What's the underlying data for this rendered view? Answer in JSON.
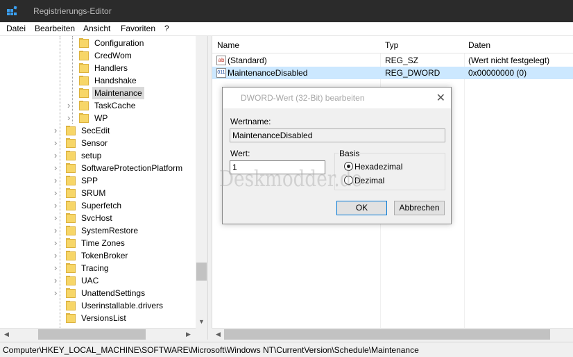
{
  "window": {
    "title": "Registrierungs-Editor"
  },
  "menu": [
    "Datei",
    "Bearbeiten",
    "Ansicht",
    "Favoriten",
    "?"
  ],
  "tree": {
    "level4": [
      {
        "label": "Configuration",
        "expander": false
      },
      {
        "label": "CredWom",
        "expander": false
      },
      {
        "label": "Handlers",
        "expander": false
      },
      {
        "label": "Handshake",
        "expander": false
      },
      {
        "label": "Maintenance",
        "expander": false,
        "selected": true
      },
      {
        "label": "TaskCache",
        "expander": true
      },
      {
        "label": "WP",
        "expander": true
      }
    ],
    "level3": [
      {
        "label": "SecEdit",
        "expander": true
      },
      {
        "label": "Sensor",
        "expander": true
      },
      {
        "label": "setup",
        "expander": true
      },
      {
        "label": "SoftwareProtectionPlatform",
        "expander": true
      },
      {
        "label": "SPP",
        "expander": true
      },
      {
        "label": "SRUM",
        "expander": true
      },
      {
        "label": "Superfetch",
        "expander": true
      },
      {
        "label": "SvcHost",
        "expander": true
      },
      {
        "label": "SystemRestore",
        "expander": true
      },
      {
        "label": "Time Zones",
        "expander": true
      },
      {
        "label": "TokenBroker",
        "expander": true
      },
      {
        "label": "Tracing",
        "expander": true
      },
      {
        "label": "UAC",
        "expander": true
      },
      {
        "label": "UnattendSettings",
        "expander": true
      },
      {
        "label": "Userinstallable.drivers",
        "expander": false
      },
      {
        "label": "VersionsList",
        "expander": false
      }
    ]
  },
  "list": {
    "headers": {
      "name": "Name",
      "type": "Typ",
      "data": "Daten"
    },
    "rows": [
      {
        "icon": "ab",
        "name": "(Standard)",
        "type": "REG_SZ",
        "data": "(Wert nicht festgelegt)",
        "selected": false
      },
      {
        "icon": "011",
        "name": "MaintenanceDisabled",
        "type": "REG_DWORD",
        "data": "0x00000000 (0)",
        "selected": true
      }
    ]
  },
  "dialog": {
    "title": "DWORD-Wert (32-Bit) bearbeiten",
    "value_name_label": "Wertname:",
    "value_name": "MaintenanceDisabled",
    "value_label": "Wert:",
    "value": "1",
    "base_label": "Basis",
    "hex_label": "Hexadezimal",
    "dec_label": "Dezimal",
    "selected_base": "Hexadezimal",
    "ok_label": "OK",
    "cancel_label": "Abbrechen"
  },
  "watermark": "Deskmodder.de",
  "status": {
    "path": "Computer\\HKEY_LOCAL_MACHINE\\SOFTWARE\\Microsoft\\Windows NT\\CurrentVersion\\Schedule\\Maintenance"
  },
  "colors": {
    "titlebar": "#2b2b2b",
    "selection": "#cce8ff",
    "folder": "#f7d668",
    "accent": "#0078d7"
  }
}
